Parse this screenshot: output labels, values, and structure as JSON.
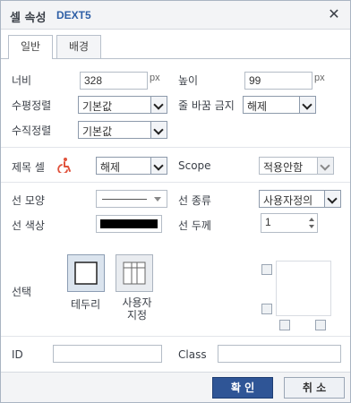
{
  "dialog": {
    "title": "셀 속성",
    "brand": "DEXT5",
    "close_icon": "close-icon"
  },
  "tabs": [
    {
      "label": "일반",
      "active": true
    },
    {
      "label": "배경",
      "active": false
    }
  ],
  "general": {
    "width_label": "너비",
    "width_value": "328",
    "width_unit": "px",
    "height_label": "높이",
    "height_value": "99",
    "height_unit": "px",
    "halign_label": "수평정렬",
    "halign_value": "기본값",
    "nowrap_label": "줄 바꿈 금지",
    "nowrap_value": "해제",
    "valign_label": "수직정렬",
    "valign_value": "기본값"
  },
  "header_cell": {
    "label": "제목 셀",
    "icon": "accessibility-icon",
    "value": "해제",
    "scope_label": "Scope",
    "scope_value": "적용안함"
  },
  "line": {
    "style_label": "선 모양",
    "type_label": "선 종류",
    "type_value": "사용자정의",
    "color_label": "선 색상",
    "color_value": "#000000",
    "thickness_label": "선 두께",
    "thickness_value": "1"
  },
  "select_border": {
    "label": "선택",
    "options": [
      {
        "label": "테두리",
        "icon": "border-outline-icon"
      },
      {
        "label": "사용자\n지정",
        "icon": "border-custom-icon"
      }
    ]
  },
  "attrs": {
    "id_label": "ID",
    "id_value": "",
    "class_label": "Class",
    "class_value": ""
  },
  "footer": {
    "ok_label": "확 인",
    "cancel_label": "취 소"
  },
  "colors": {
    "accent": "#2f5596",
    "brand": "#2e5fa6",
    "accessibility_icon": "#e0533d"
  }
}
